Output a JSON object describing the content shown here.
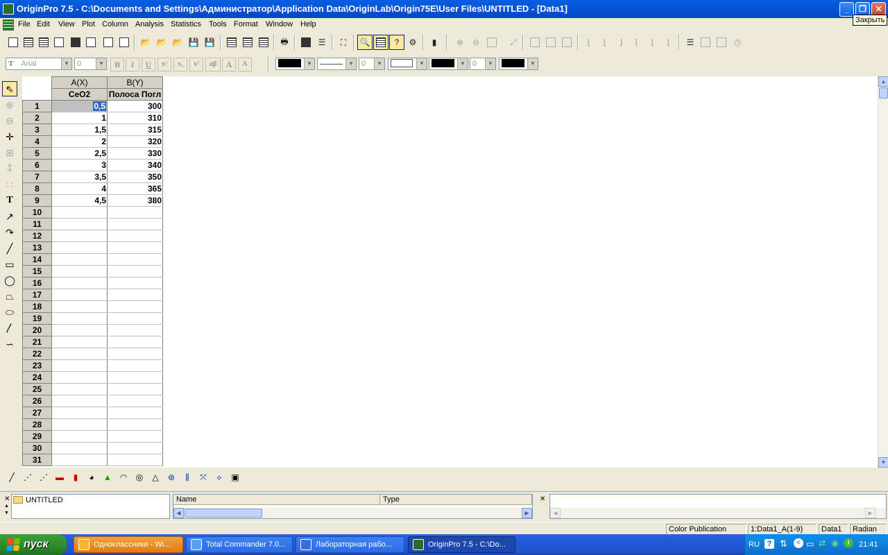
{
  "window": {
    "title": "OriginPro 7.5 - C:\\Documents and Settings\\Администратор\\Application Data\\OriginLab\\Origin75E\\User Files\\UNTITLED - [Data1]",
    "tooltip": "Закрыть"
  },
  "menu": [
    "File",
    "Edit",
    "View",
    "Plot",
    "Column",
    "Analysis",
    "Statistics",
    "Tools",
    "Format",
    "Window",
    "Help"
  ],
  "format_toolbar": {
    "font": "Arial",
    "font_size": "0",
    "bold": "B",
    "italic": "I",
    "underline": "U",
    "line_width": "0",
    "pattern_width": "0"
  },
  "worksheet": {
    "columns": [
      {
        "header": "A(X)",
        "label": "CeO2"
      },
      {
        "header": "B(Y)",
        "label": "Полоса Погл"
      }
    ],
    "rows": [
      {
        "n": "1",
        "a": "0,5",
        "b": "300"
      },
      {
        "n": "2",
        "a": "1",
        "b": "310"
      },
      {
        "n": "3",
        "a": "1,5",
        "b": "315"
      },
      {
        "n": "4",
        "a": "2",
        "b": "320"
      },
      {
        "n": "5",
        "a": "2,5",
        "b": "330"
      },
      {
        "n": "6",
        "a": "3",
        "b": "340"
      },
      {
        "n": "7",
        "a": "3,5",
        "b": "350"
      },
      {
        "n": "8",
        "a": "4",
        "b": "365"
      },
      {
        "n": "9",
        "a": "4,5",
        "b": "380"
      },
      {
        "n": "10",
        "a": "",
        "b": ""
      },
      {
        "n": "11",
        "a": "",
        "b": ""
      },
      {
        "n": "12",
        "a": "",
        "b": ""
      },
      {
        "n": "13",
        "a": "",
        "b": ""
      },
      {
        "n": "14",
        "a": "",
        "b": ""
      },
      {
        "n": "15",
        "a": "",
        "b": ""
      },
      {
        "n": "16",
        "a": "",
        "b": ""
      },
      {
        "n": "17",
        "a": "",
        "b": ""
      },
      {
        "n": "18",
        "a": "",
        "b": ""
      },
      {
        "n": "19",
        "a": "",
        "b": ""
      },
      {
        "n": "20",
        "a": "",
        "b": ""
      },
      {
        "n": "21",
        "a": "",
        "b": ""
      },
      {
        "n": "22",
        "a": "",
        "b": ""
      },
      {
        "n": "23",
        "a": "",
        "b": ""
      },
      {
        "n": "24",
        "a": "",
        "b": ""
      },
      {
        "n": "25",
        "a": "",
        "b": ""
      },
      {
        "n": "26",
        "a": "",
        "b": ""
      },
      {
        "n": "27",
        "a": "",
        "b": ""
      },
      {
        "n": "28",
        "a": "",
        "b": ""
      },
      {
        "n": "29",
        "a": "",
        "b": ""
      },
      {
        "n": "30",
        "a": "",
        "b": ""
      },
      {
        "n": "31",
        "a": "",
        "b": ""
      }
    ]
  },
  "explorer": {
    "folder": "UNTITLED",
    "columns": [
      "Name",
      "Type"
    ]
  },
  "status": {
    "color_mode": "Color Publication",
    "selection": "1:Data1_A(1-9)",
    "window": "Data1",
    "angle_unit": "Radian"
  },
  "taskbar": {
    "start": "пуск",
    "tasks": [
      {
        "label": "Одноклассники - Wi...",
        "style": "orange",
        "icon_color": "#F7B531"
      },
      {
        "label": "Total Commander 7.0...",
        "style": "normal",
        "icon_color": "#5AA2E8"
      },
      {
        "label": "Лабораторная рабо...",
        "style": "normal",
        "icon_color": "#3B6FD1"
      },
      {
        "label": "OriginPro 7.5 - C:\\Do...",
        "style": "active",
        "icon_color": "#2B6C2B"
      }
    ],
    "language": "RU",
    "clock": "21:41"
  }
}
